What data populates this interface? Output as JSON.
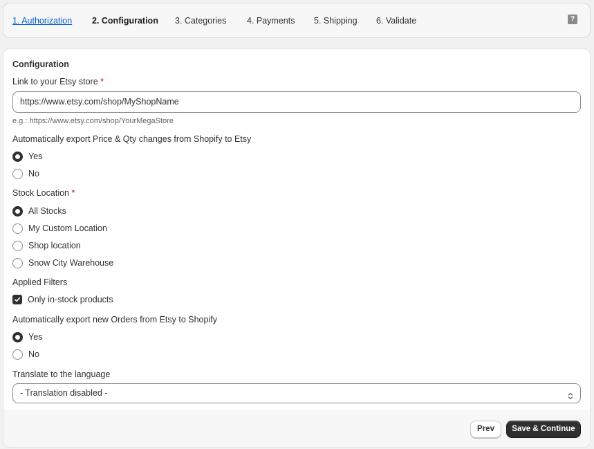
{
  "steps": [
    {
      "label": "1. Authorization",
      "state": "link"
    },
    {
      "label": "2. Configuration",
      "state": "active"
    },
    {
      "label": "3. Categories",
      "state": "default"
    },
    {
      "label": "4. Payments",
      "state": "default"
    },
    {
      "label": "5. Shipping",
      "state": "default"
    },
    {
      "label": "6. Validate",
      "state": "default"
    }
  ],
  "help": {
    "icon": "question-icon",
    "glyph": "?"
  },
  "config": {
    "title": "Configuration",
    "store_link": {
      "label": "Link to your Etsy store",
      "required_mark": "*",
      "value": "https://www.etsy.com/shop/MyShopName",
      "hint": "e.g.: https://www.etsy.com/shop/YourMegaStore"
    },
    "export_price_qty": {
      "label": "Automatically export Price & Qty changes from Shopify to Etsy",
      "options": [
        "Yes",
        "No"
      ],
      "selected": "Yes"
    },
    "stock_location": {
      "label": "Stock Location",
      "required_mark": "*",
      "options": [
        "All Stocks",
        "My Custom Location",
        "Shop location",
        "Snow City Warehouse"
      ],
      "selected": "All Stocks"
    },
    "applied_filters": {
      "label": "Applied Filters",
      "checkbox_label": "Only in-stock products",
      "checked": true
    },
    "export_orders": {
      "label": "Automatically export new Orders from Etsy to Shopify",
      "options": [
        "Yes",
        "No"
      ],
      "selected": "Yes"
    },
    "translate": {
      "label": "Translate to the language",
      "selected": "- Translation disabled -"
    }
  },
  "footer": {
    "prev_label": "Prev",
    "save_label": "Save & Continue"
  },
  "colors": {
    "link": "#005bd3",
    "primary_button": "#303030",
    "required": "#c70a24",
    "background": "#f1f1f1"
  }
}
